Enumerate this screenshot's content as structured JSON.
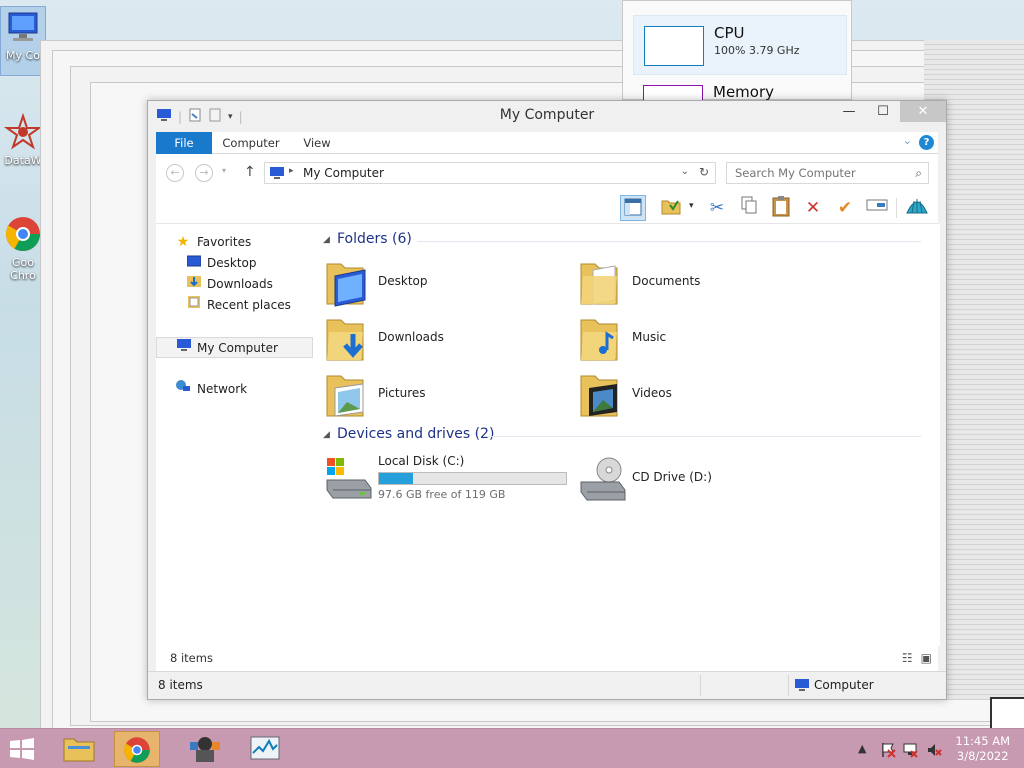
{
  "desktop": {
    "icons": [
      {
        "label": "My Co",
        "icon": "computer-icon"
      },
      {
        "label": "DataW",
        "icon": "datawatch-icon"
      },
      {
        "label": "Goo Chro",
        "icon": "chrome-icon"
      }
    ]
  },
  "taskmgr": {
    "items": [
      {
        "name": "CPU",
        "value": "100% 3.79 GHz",
        "color": "#117dbb"
      },
      {
        "name": "Memory",
        "value": "",
        "color": "#8b12ae"
      }
    ]
  },
  "window": {
    "title": "My Computer",
    "controls": {
      "minimize": "—",
      "maximize": "☐",
      "close": "✕"
    },
    "ribbon": {
      "tabs": [
        "File",
        "Computer",
        "View"
      ],
      "help": "?"
    },
    "address": {
      "path": "My Computer"
    },
    "search": {
      "placeholder": "Search My Computer"
    },
    "nav": {
      "favorites": {
        "label": "Favorites",
        "items": [
          "Desktop",
          "Downloads",
          "Recent places"
        ]
      },
      "computer": "My Computer",
      "network": "Network"
    },
    "groups": {
      "folders": {
        "title": "Folders (6)",
        "items": [
          "Desktop",
          "Documents",
          "Downloads",
          "Music",
          "Pictures",
          "Videos"
        ]
      },
      "drives": {
        "title": "Devices and drives (2)",
        "items": [
          {
            "name": "Local Disk (C:)",
            "free": "97.6 GB free of 119 GB",
            "used_fraction": 0.18
          },
          {
            "name": "CD Drive (D:)"
          }
        ]
      }
    },
    "status": {
      "count": "8 items",
      "location": "Computer"
    }
  },
  "taskbar": {
    "clock": {
      "time": "11:45 AM",
      "date": "3/8/2022"
    }
  },
  "colors": {
    "accent": "#1979ca",
    "taskbar": "#c79ab2",
    "progress": "#26a0da"
  }
}
